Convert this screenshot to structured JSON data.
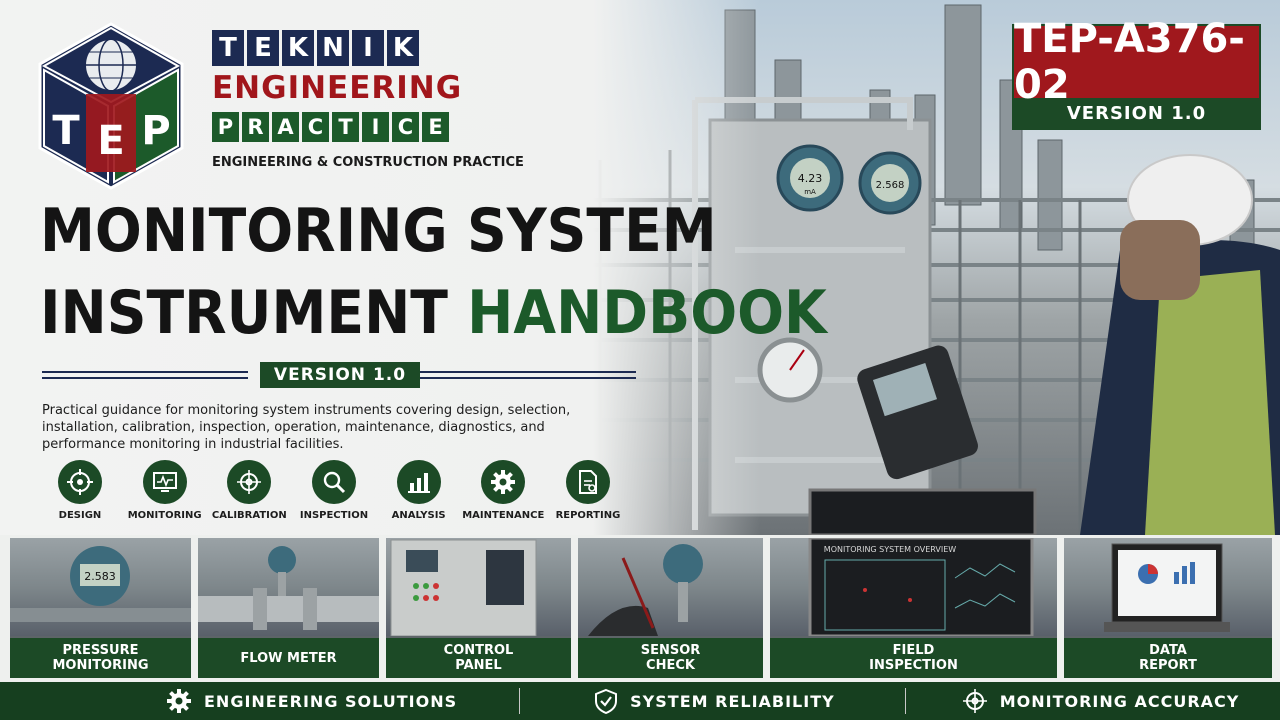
{
  "brand": {
    "logo_letters": "TEP",
    "teknik": [
      "T",
      "E",
      "K",
      "N",
      "I",
      "K"
    ],
    "engineering": "ENGINEERING",
    "practice": [
      "P",
      "R",
      "A",
      "C",
      "T",
      "I",
      "C",
      "E"
    ],
    "subtitle": "ENGINEERING & CONSTRUCTION PRACTICE"
  },
  "title": {
    "line1": "MONITORING SYSTEM",
    "line2_a": "INSTRUMENT ",
    "line2_b": "HANDBOOK"
  },
  "version_label": "VERSION 1.0",
  "description": "Practical guidance for monitoring system instruments covering design, selection, installation, calibration, inspection, operation, maintenance, diagnostics, and performance monitoring in industrial facilities.",
  "topics": [
    {
      "label": "DESIGN",
      "icon": "target-icon"
    },
    {
      "label": "MONITORING",
      "icon": "monitor-icon"
    },
    {
      "label": "CALIBRATION",
      "icon": "crosshair-icon"
    },
    {
      "label": "INSPECTION",
      "icon": "magnifier-icon"
    },
    {
      "label": "ANALYSIS",
      "icon": "bar-chart-icon"
    },
    {
      "label": "MAINTENANCE",
      "icon": "gear-icon"
    },
    {
      "label": "REPORTING",
      "icon": "report-icon"
    }
  ],
  "code_badge": {
    "code": "TEP-A376-02",
    "version": "VERSION 1.0"
  },
  "scene": {
    "transmitter_1": "4.23",
    "transmitter_1_unit": "mA",
    "transmitter_2": "2.568",
    "screen_title": "MONITORING SYSTEM OVERVIEW",
    "card_display": "2.583"
  },
  "cards": [
    {
      "line1": "PRESSURE",
      "line2": "MONITORING"
    },
    {
      "line1": "FLOW METER",
      "line2": ""
    },
    {
      "line1": "CONTROL",
      "line2": "PANEL"
    },
    {
      "line1": "SENSOR",
      "line2": "CHECK"
    },
    {
      "line1": "FIELD",
      "line2": "INSPECTION"
    },
    {
      "line1": "DATA",
      "line2": "REPORT"
    }
  ],
  "footer": [
    {
      "label": "ENGINEERING SOLUTIONS",
      "icon": "gear-icon"
    },
    {
      "label": "SYSTEM RELIABILITY",
      "icon": "shield-check-icon"
    },
    {
      "label": "MONITORING ACCURACY",
      "icon": "crosshair-icon"
    }
  ],
  "colors": {
    "navy": "#1c2a52",
    "red": "#a0181d",
    "green": "#1c4a26"
  }
}
